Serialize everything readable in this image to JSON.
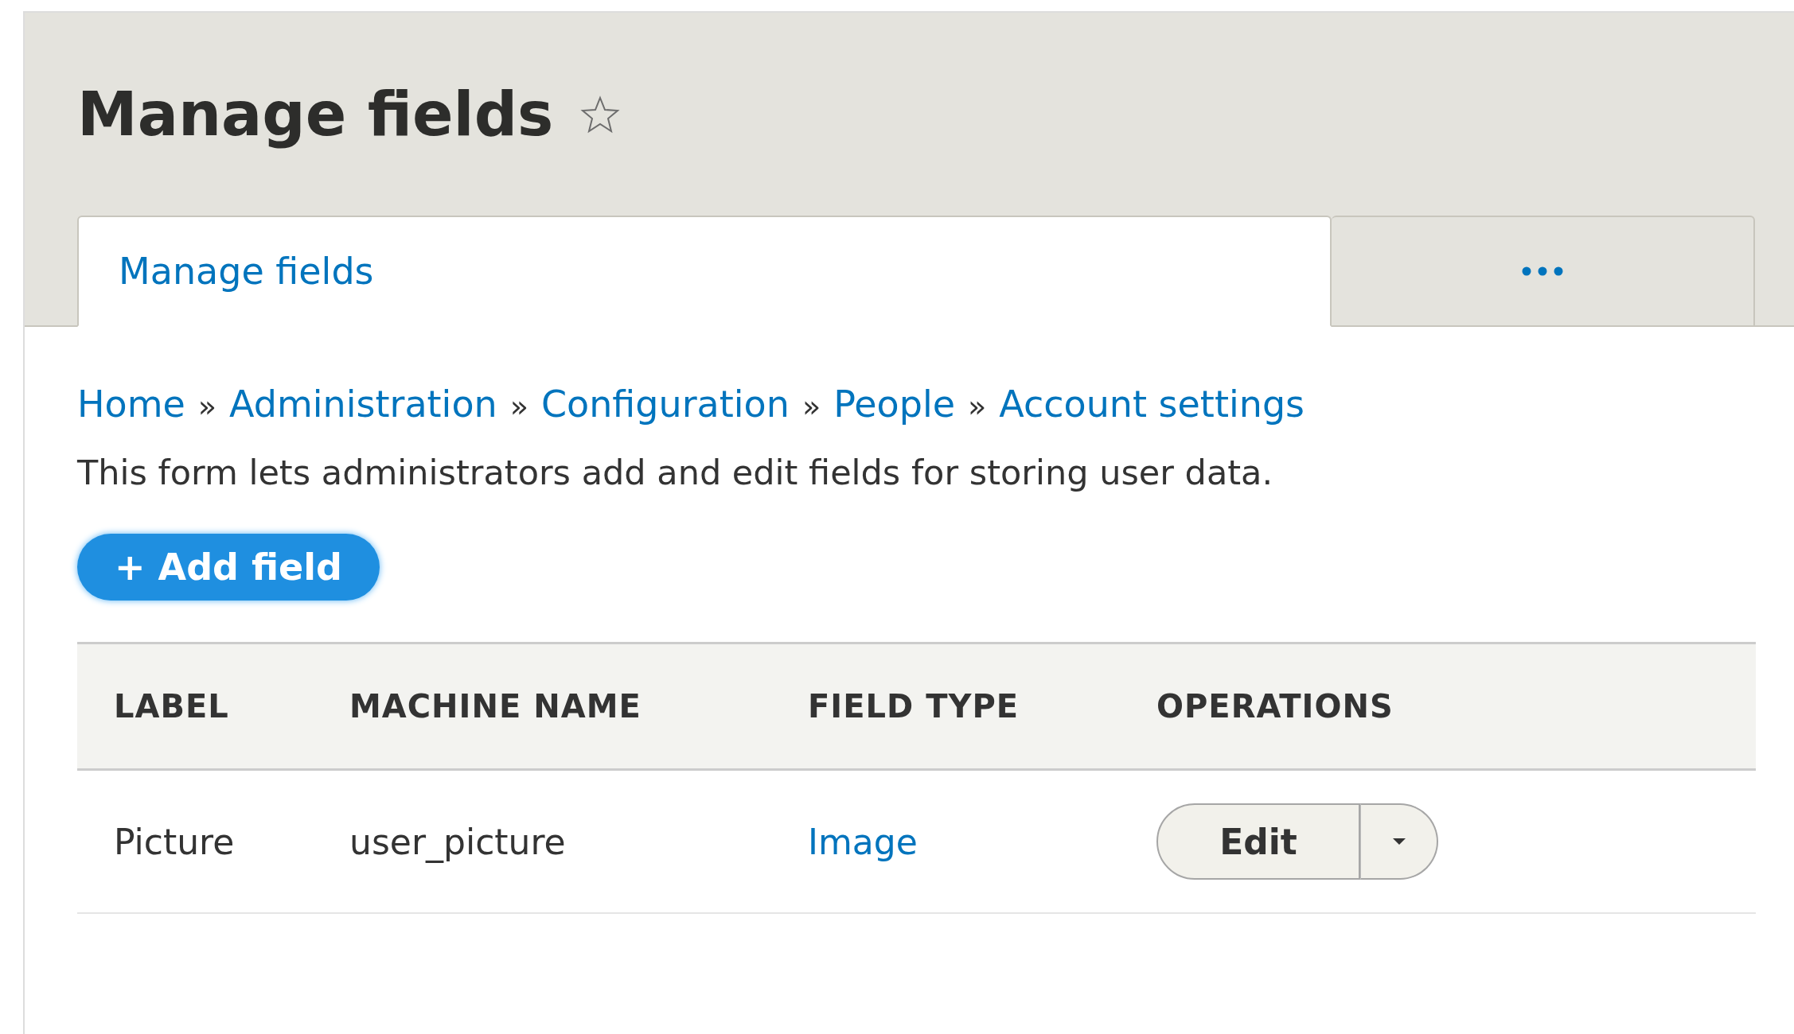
{
  "page_title": "Manage fields",
  "favorite": {
    "on": false
  },
  "tabs": [
    {
      "kind": "link",
      "label": "Manage fields",
      "selected": true
    },
    {
      "kind": "more",
      "selected": false
    }
  ],
  "breadcrumb": [
    {
      "kind": "link",
      "text": "Home"
    },
    {
      "kind": "separator",
      "text": "»"
    },
    {
      "kind": "link",
      "text": "Administration"
    },
    {
      "kind": "separator",
      "text": "»"
    },
    {
      "kind": "link",
      "text": "Configuration"
    },
    {
      "kind": "separator",
      "text": "»"
    },
    {
      "kind": "link",
      "text": "People"
    },
    {
      "kind": "separator",
      "text": "»"
    },
    {
      "kind": "link",
      "text": "Account settings"
    }
  ],
  "description": "This form lets administrators add and edit fields for storing user data.",
  "add_button": "+ Add field",
  "table": {
    "columns": [
      "LABEL",
      "MACHINE NAME",
      "FIELD TYPE",
      "OPERATIONS"
    ],
    "rows": [
      {
        "label": "Picture",
        "machine_name": "user_picture",
        "field_type": "Image",
        "operation": "Edit"
      }
    ]
  }
}
